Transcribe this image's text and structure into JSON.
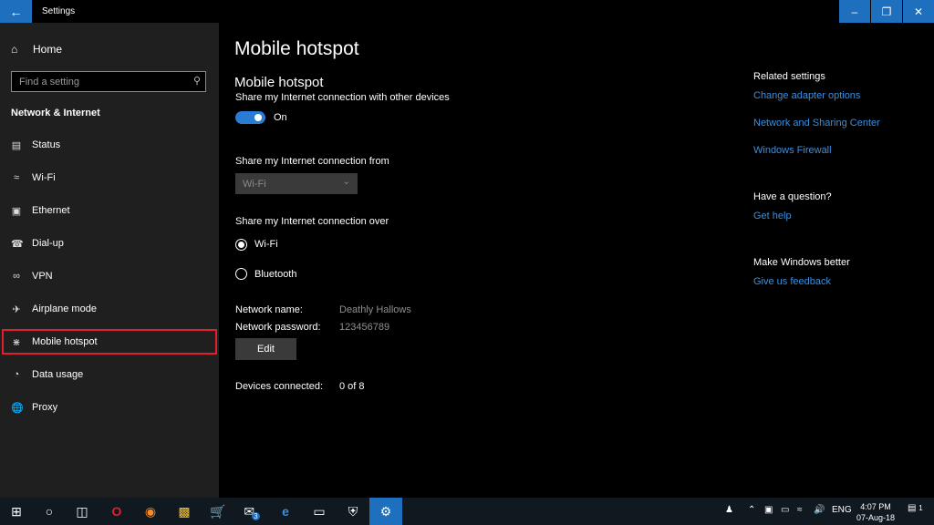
{
  "window": {
    "title": "Settings",
    "back_icon": "back-arrow-icon",
    "minimize_icon": "minimize-icon",
    "restore_icon": "restore-icon",
    "close_icon": "close-icon"
  },
  "sidebar": {
    "home_label": "Home",
    "search_placeholder": "Find a setting",
    "section_title": "Network & Internet",
    "items": [
      {
        "label": "Status",
        "icon": "status-icon"
      },
      {
        "label": "Wi-Fi",
        "icon": "wifi-icon"
      },
      {
        "label": "Ethernet",
        "icon": "ethernet-icon"
      },
      {
        "label": "Dial-up",
        "icon": "dialup-icon"
      },
      {
        "label": "VPN",
        "icon": "vpn-icon"
      },
      {
        "label": "Airplane mode",
        "icon": "airplane-icon"
      },
      {
        "label": "Mobile hotspot",
        "icon": "hotspot-icon"
      },
      {
        "label": "Data usage",
        "icon": "data-usage-icon"
      },
      {
        "label": "Proxy",
        "icon": "proxy-icon"
      }
    ]
  },
  "main": {
    "page_title": "Mobile hotspot",
    "section_title": "Mobile hotspot",
    "share_description": "Share my Internet connection with other devices",
    "toggle_state": "On",
    "share_from_label": "Share my Internet connection from",
    "share_from_value": "Wi-Fi",
    "share_over_label": "Share my Internet connection over",
    "share_over_options": [
      "Wi-Fi",
      "Bluetooth"
    ],
    "share_over_selected": "Wi-Fi",
    "network_name_label": "Network name:",
    "network_name_value": "Deathly Hallows",
    "network_password_label": "Network password:",
    "network_password_value": "123456789",
    "edit_label": "Edit",
    "devices_connected_label": "Devices connected:",
    "devices_connected_value": "0 of 8"
  },
  "related": {
    "title": "Related settings",
    "links": [
      "Change adapter options",
      "Network and Sharing Center",
      "Windows Firewall"
    ],
    "question_title": "Have a question?",
    "question_link": "Get help",
    "better_title": "Make Windows better",
    "better_link": "Give us feedback"
  },
  "taskbar": {
    "language": "ENG",
    "time": "4:07 PM",
    "date": "07-Aug-18",
    "mail_badge": "3",
    "notification_badge": "1"
  },
  "colors": {
    "accent": "#1f6fbf",
    "link": "#3a8fe0",
    "selection_outline": "#e0202e",
    "sidebar_bg": "#1f1f1f"
  }
}
